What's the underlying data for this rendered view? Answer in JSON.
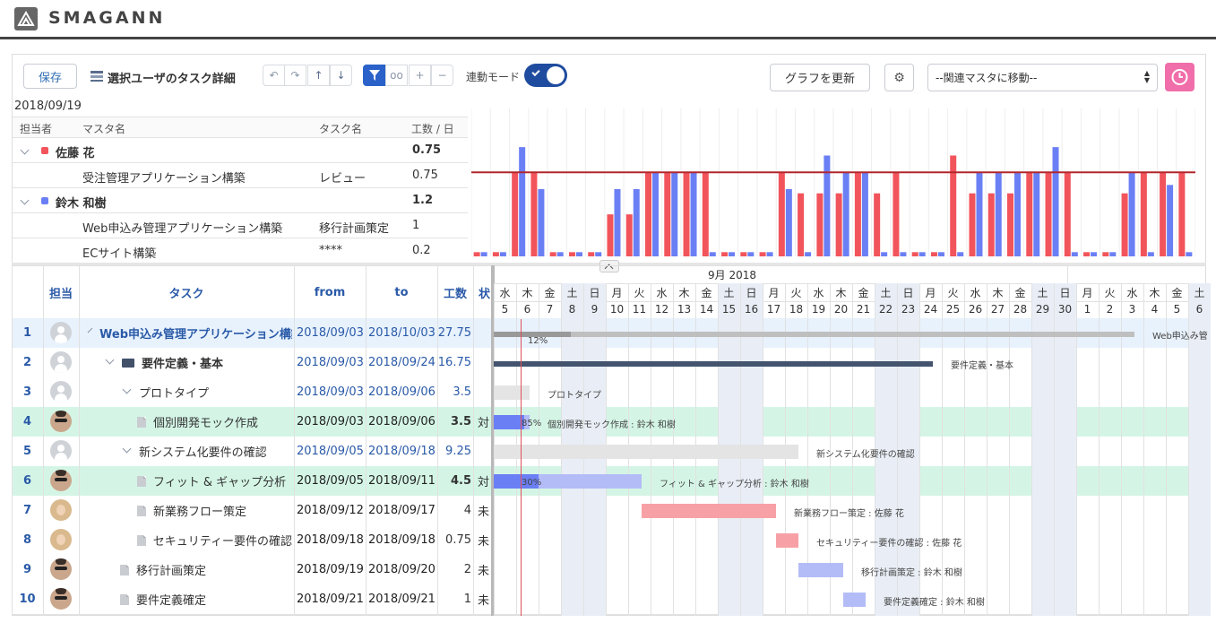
{
  "header": {
    "brand": "SMAGANN"
  },
  "toolbar": {
    "save_label": "保存",
    "title": "選択ユーザのタスク詳細",
    "sync_mode_label": "連動モード",
    "update_graph_label": "グラフを更新",
    "master_select_value": "--関連マスタに移動--"
  },
  "summary": {
    "date": "2018/09/19",
    "columns": [
      "担当者",
      "マスタ名",
      "タスク名",
      "工数 / 日"
    ],
    "groups": [
      {
        "name": "佐藤 花",
        "total": "0.75",
        "color": "#f2545b",
        "rows": [
          {
            "master": "受注管理アプリケーション構築",
            "task": "レビュー",
            "value": "0.75"
          }
        ]
      },
      {
        "name": "鈴木 和樹",
        "total": "1.2",
        "color": "#6b7ff5",
        "rows": [
          {
            "master": "Web申込み管理アプリケーション構築",
            "task": "移行計画策定",
            "value": "1"
          },
          {
            "master": "ECサイト構築",
            "task": "****",
            "value": "0.2"
          }
        ]
      }
    ]
  },
  "chart_data": {
    "type": "bar",
    "series": [
      {
        "color": "#f2545b",
        "values": [
          0.05,
          0.05,
          1.0,
          1.0,
          0.05,
          0.05,
          0.05,
          0.5,
          0.5,
          1.0,
          1.0,
          1.0,
          1.0,
          0.05,
          0.05,
          0.05,
          1.0,
          0.75,
          0.75,
          0.75,
          1.0,
          0.75,
          1.0,
          0.05,
          0.05,
          1.2,
          0.75,
          0.75,
          0.75,
          1.0,
          1.0,
          1.0,
          0.05,
          0.05,
          0.75,
          1.0,
          1.0,
          1.0
        ]
      },
      {
        "color": "#6b7ff5",
        "values": [
          0.05,
          0.05,
          1.3,
          0.8,
          0.05,
          0.05,
          0.05,
          0.8,
          0.8,
          1.0,
          1.0,
          1.0,
          0.05,
          0.05,
          0.05,
          0.05,
          0.8,
          0.05,
          1.2,
          1.0,
          1.0,
          0.05,
          0.05,
          0.05,
          0.05,
          0.05,
          1.0,
          1.0,
          1.0,
          1.0,
          1.3,
          0.05,
          0.05,
          0.05,
          1.0,
          0.05,
          0.85,
          0.05
        ]
      }
    ],
    "threshold": 1.0,
    "ylim": [
      0,
      1.6
    ]
  },
  "grid": {
    "columns": {
      "owner": "担当",
      "task": "タスク",
      "from": "from",
      "to": "to",
      "effort": "工数",
      "status": "状"
    },
    "month_label": "9月 2018",
    "days": [
      {
        "w": "水",
        "d": "5"
      },
      {
        "w": "木",
        "d": "6"
      },
      {
        "w": "金",
        "d": "7"
      },
      {
        "w": "土",
        "d": "8"
      },
      {
        "w": "日",
        "d": "9"
      },
      {
        "w": "月",
        "d": "10"
      },
      {
        "w": "火",
        "d": "11"
      },
      {
        "w": "水",
        "d": "12"
      },
      {
        "w": "木",
        "d": "13"
      },
      {
        "w": "金",
        "d": "14"
      },
      {
        "w": "土",
        "d": "15"
      },
      {
        "w": "日",
        "d": "16"
      },
      {
        "w": "月",
        "d": "17"
      },
      {
        "w": "火",
        "d": "18"
      },
      {
        "w": "水",
        "d": "19"
      },
      {
        "w": "木",
        "d": "20"
      },
      {
        "w": "金",
        "d": "21"
      },
      {
        "w": "土",
        "d": "22"
      },
      {
        "w": "日",
        "d": "23"
      },
      {
        "w": "月",
        "d": "24"
      },
      {
        "w": "火",
        "d": "25"
      },
      {
        "w": "水",
        "d": "26"
      },
      {
        "w": "木",
        "d": "27"
      },
      {
        "w": "金",
        "d": "28"
      },
      {
        "w": "土",
        "d": "29"
      },
      {
        "w": "日",
        "d": "30"
      },
      {
        "w": "月",
        "d": "1"
      },
      {
        "w": "火",
        "d": "2"
      },
      {
        "w": "水",
        "d": "3"
      },
      {
        "w": "木",
        "d": "4"
      },
      {
        "w": "金",
        "d": "5"
      },
      {
        "w": "土",
        "d": "6"
      }
    ],
    "rows": [
      {
        "num": "1",
        "avatar": "generic",
        "icon": "chevron",
        "indent": 0,
        "name": "Web申込み管理アプリケーション構築",
        "bold": true,
        "from": "2018/09/03",
        "to": "2018/10/03",
        "effort": "27.75",
        "status": "",
        "highlight": "sel"
      },
      {
        "num": "2",
        "avatar": "generic",
        "icon": "folder",
        "indent": 1,
        "name": "要件定義・基本",
        "bold": true,
        "from": "2018/09/03",
        "to": "2018/09/24",
        "effort": "16.75",
        "status": "",
        "highlight": ""
      },
      {
        "num": "3",
        "avatar": "generic",
        "icon": "chevron",
        "indent": 2,
        "name": "プロトタイプ",
        "bold": false,
        "from": "2018/09/03",
        "to": "2018/09/06",
        "effort": "3.5",
        "status": "",
        "highlight": ""
      },
      {
        "num": "4",
        "avatar": "male",
        "icon": "doc",
        "indent": 3,
        "name": "個別開発モック作成",
        "bold": false,
        "from": "2018/09/03",
        "to": "2018/09/06",
        "effort": "3.5",
        "status": "対",
        "highlight": "green"
      },
      {
        "num": "5",
        "avatar": "generic",
        "icon": "chevron",
        "indent": 2,
        "name": "新システム化要件の確認",
        "bold": false,
        "from": "2018/09/05",
        "to": "2018/09/18",
        "effort": "9.25",
        "status": "",
        "highlight": ""
      },
      {
        "num": "6",
        "avatar": "male",
        "icon": "doc",
        "indent": 3,
        "name": "フィット & ギャップ分析",
        "bold": false,
        "from": "2018/09/05",
        "to": "2018/09/11",
        "effort": "4.5",
        "status": "対",
        "highlight": "green"
      },
      {
        "num": "7",
        "avatar": "female",
        "icon": "doc",
        "indent": 3,
        "name": "新業務フロー策定",
        "bold": false,
        "from": "2018/09/12",
        "to": "2018/09/17",
        "effort": "4",
        "status": "未",
        "highlight": ""
      },
      {
        "num": "8",
        "avatar": "female",
        "icon": "doc",
        "indent": 3,
        "name": "セキュリティー要件の確認",
        "bold": false,
        "from": "2018/09/18",
        "to": "2018/09/18",
        "effort": "0.75",
        "status": "未",
        "highlight": ""
      },
      {
        "num": "9",
        "avatar": "male",
        "icon": "doc",
        "indent": 2,
        "name": "移行計画策定",
        "bold": false,
        "from": "2018/09/19",
        "to": "2018/09/20",
        "effort": "2",
        "status": "未",
        "highlight": ""
      },
      {
        "num": "10",
        "avatar": "male",
        "icon": "doc",
        "indent": 2,
        "name": "要件定義確定",
        "bold": false,
        "from": "2018/09/21",
        "to": "2018/09/21",
        "effort": "1",
        "status": "未",
        "highlight": ""
      }
    ],
    "bars": [
      {
        "row": 0,
        "start": 0,
        "end": 28.6,
        "color": "#bfbfbf",
        "progress": 0.12,
        "pcolor": "#999",
        "pct": "12%",
        "label": "Web申込み管",
        "thin": true
      },
      {
        "row": 1,
        "start": 0,
        "end": 19.6,
        "color": "#44546e",
        "progress": 0,
        "pcolor": "",
        "pct": "",
        "label": "要件定義・基本",
        "thin": true
      },
      {
        "row": 2,
        "start": 0,
        "end": 1.6,
        "color": "#e4e4e4",
        "progress": 0,
        "pcolor": "",
        "pct": "",
        "label": "プロトタイプ",
        "thin": false
      },
      {
        "row": 3,
        "start": 0,
        "end": 1.6,
        "color": "#b3bcf7",
        "progress": 0.85,
        "pcolor": "#6b7ff5",
        "pct": "85%",
        "label": "個別開発モック作成 : 鈴木 和樹",
        "thin": false
      },
      {
        "row": 4,
        "start": 0,
        "end": 13.6,
        "color": "#e4e4e4",
        "progress": 0,
        "pcolor": "",
        "pct": "",
        "label": "新システム化要件の確認",
        "thin": false
      },
      {
        "row": 5,
        "start": 0,
        "end": 6.6,
        "color": "#b3bcf7",
        "progress": 0.3,
        "pcolor": "#6b7ff5",
        "pct": "30%",
        "label": "フィット & ギャップ分析 : 鈴木 和樹",
        "thin": false
      },
      {
        "row": 6,
        "start": 6.6,
        "end": 12.6,
        "color": "#f7a1a6",
        "progress": 0,
        "pcolor": "",
        "pct": "",
        "label": "新業務フロー策定 : 佐藤 花",
        "thin": false
      },
      {
        "row": 7,
        "start": 12.6,
        "end": 13.6,
        "color": "#f7a1a6",
        "progress": 0,
        "pcolor": "",
        "pct": "",
        "label": "セキュリティー要件の確認 : 佐藤 花",
        "thin": false
      },
      {
        "row": 8,
        "start": 13.6,
        "end": 15.6,
        "color": "#b3bcf7",
        "progress": 0,
        "pcolor": "",
        "pct": "",
        "label": "移行計画策定 : 鈴木 和樹",
        "thin": false
      },
      {
        "row": 9,
        "start": 15.6,
        "end": 16.6,
        "color": "#b3bcf7",
        "progress": 0,
        "pcolor": "",
        "pct": "",
        "label": "要件定義確定 : 鈴木 和樹",
        "thin": false
      }
    ]
  }
}
